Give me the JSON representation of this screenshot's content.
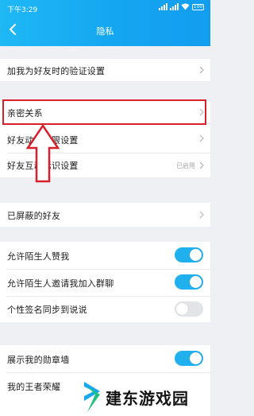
{
  "status_bar": {
    "time": "下午3:29",
    "battery": "100"
  },
  "header": {
    "title": "隐私"
  },
  "groups": [
    {
      "items": [
        {
          "label": "加我为好友时的验证设置"
        }
      ]
    },
    {
      "items": [
        {
          "label": "亲密关系"
        },
        {
          "label": "好友动态权限设置"
        },
        {
          "label": "好友互动标识设置",
          "value": "已启用"
        }
      ]
    },
    {
      "items": [
        {
          "label": "已屏蔽的好友"
        }
      ]
    },
    {
      "items": [
        {
          "label": "允许陌生人赞我",
          "toggle": "on"
        },
        {
          "label": "允许陌生人邀请我加入群聊",
          "toggle": "on"
        },
        {
          "label": "个性签名同步到说说",
          "toggle": "off"
        }
      ]
    },
    {
      "items": [
        {
          "label": "展示我的勋章墙",
          "toggle": "on"
        },
        {
          "label": "我的王者荣耀"
        }
      ]
    }
  ],
  "watermark": {
    "text": "建东游戏园"
  },
  "colors": {
    "header": "#14a6f0",
    "toggle_on": "#21b0ee",
    "highlight": "#d8202b"
  }
}
